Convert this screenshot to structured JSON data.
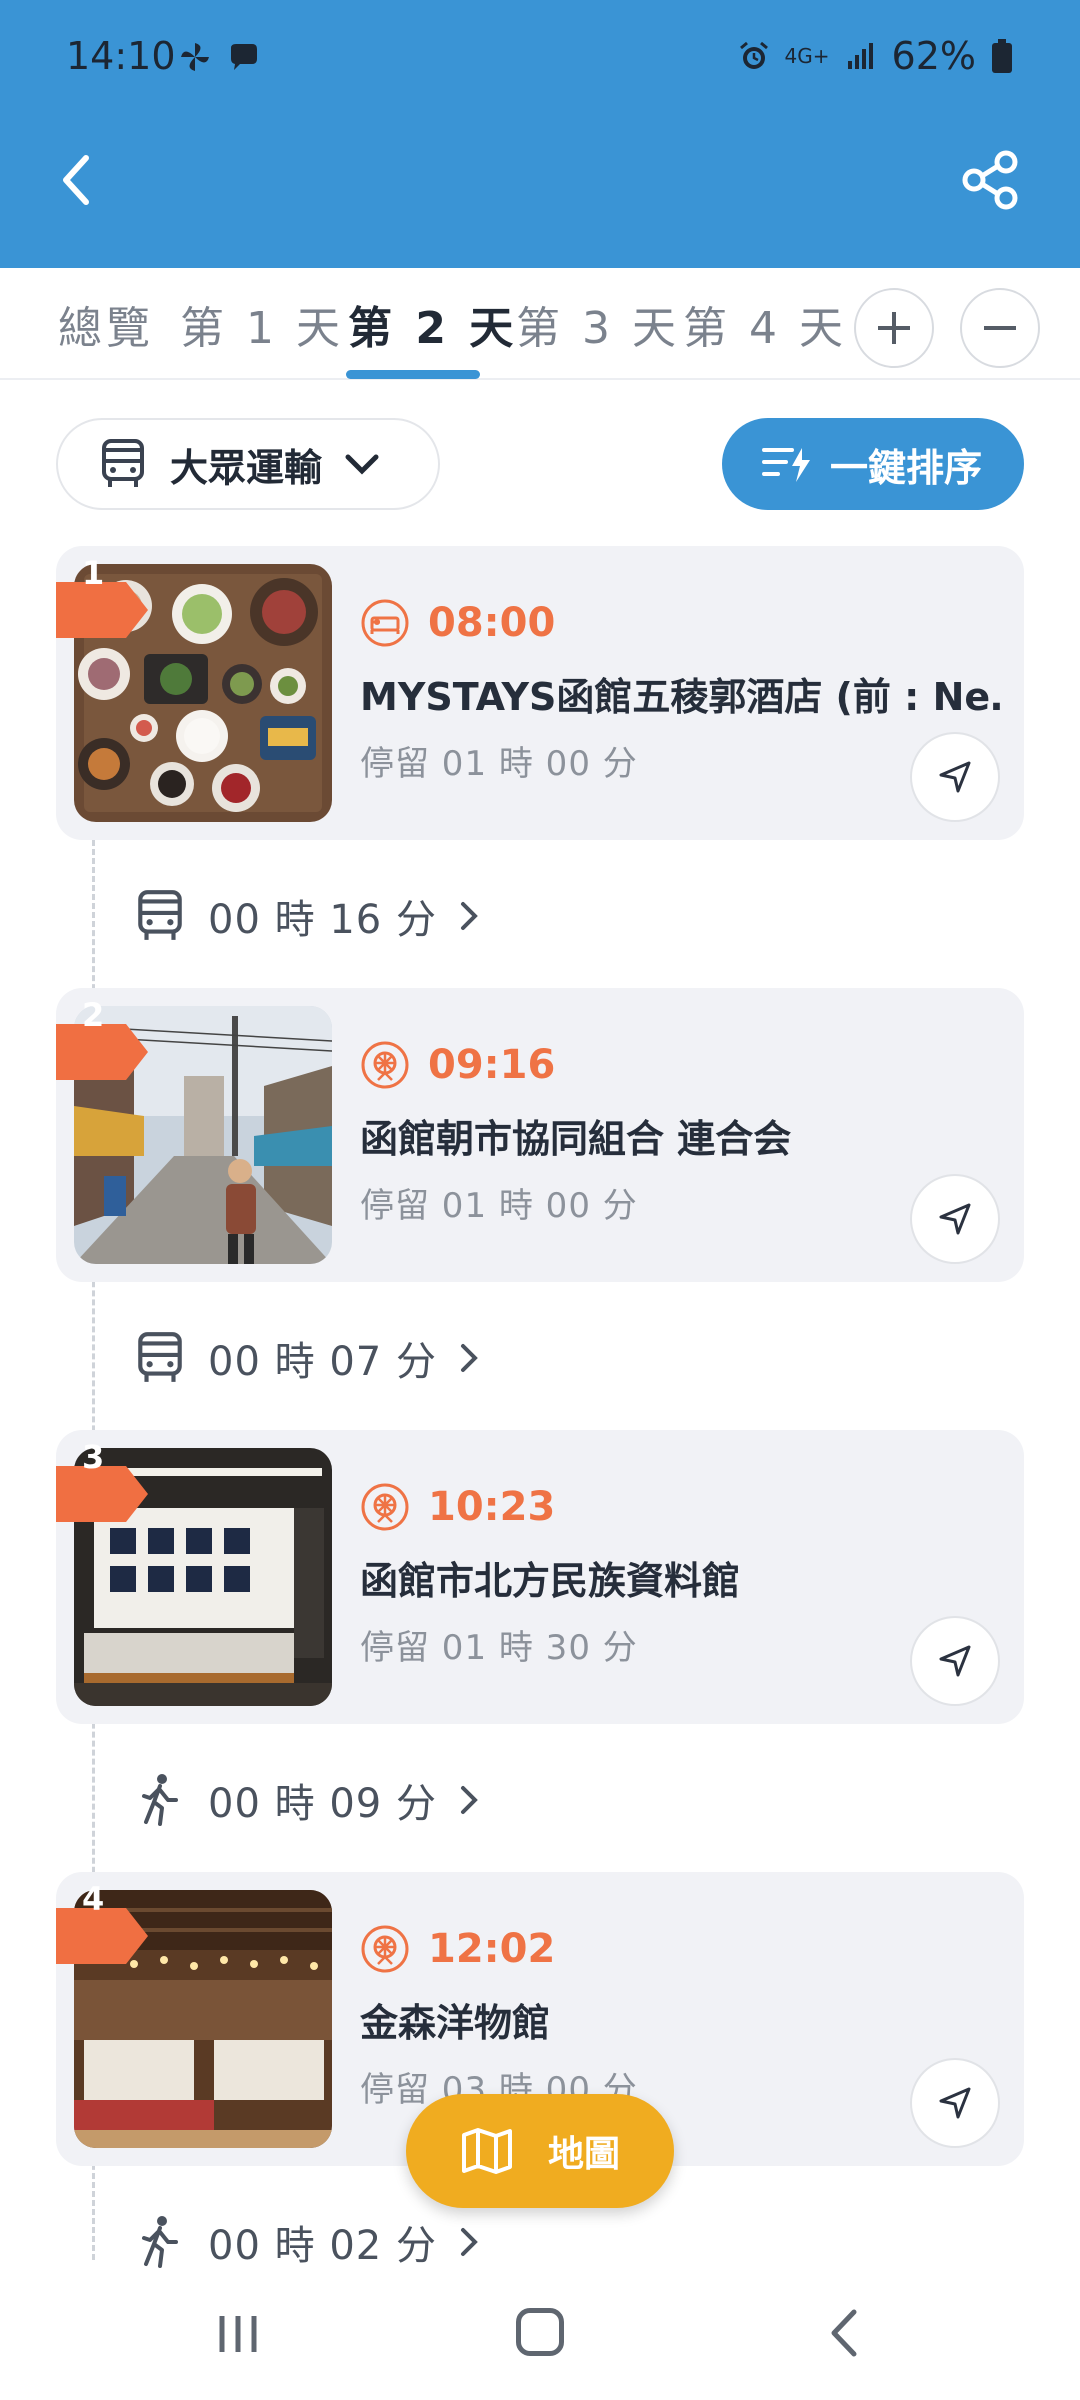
{
  "status": {
    "time": "14:10",
    "battery": "62%",
    "network": "4G+"
  },
  "tabs": [
    {
      "label": "總覽"
    },
    {
      "label": "第 1 天"
    },
    {
      "label": "第 2 天"
    },
    {
      "label": "第 3 天"
    },
    {
      "label": "第 4 天"
    }
  ],
  "active_tab": "第 2 天",
  "controls": {
    "transport_label": "大眾運輸",
    "sort_label": "一鍵排序"
  },
  "stops": [
    {
      "num": "1",
      "time": "08:00",
      "title": "MYSTAYS函館五稜郭酒店 (前 : Ne…",
      "stay": "停留 01 時 00 分",
      "icon": "hotel-icon"
    },
    {
      "num": "2",
      "time": "09:16",
      "title": "函館朝市協同組合 連合会",
      "stay": "停留 01 時 00 分",
      "icon": "attraction-icon"
    },
    {
      "num": "3",
      "time": "10:23",
      "title": "函館市北方民族資料館",
      "stay": "停留 01 時 30 分",
      "icon": "attraction-icon"
    },
    {
      "num": "4",
      "time": "12:02",
      "title": "金森洋物館",
      "stay": "停留 03 時 00 分",
      "icon": "attraction-icon"
    }
  ],
  "segments": [
    {
      "mode": "bus-icon",
      "duration": "00 時 16 分"
    },
    {
      "mode": "bus-icon",
      "duration": "00 時 07 分"
    },
    {
      "mode": "walk-icon",
      "duration": "00 時 09 分"
    },
    {
      "mode": "walk-icon",
      "duration": "00 時 02 分"
    }
  ],
  "map_button": {
    "label": "地圖"
  },
  "colors": {
    "header_blue": "#3a94d5",
    "accent_orange": "#ef7345",
    "map_yellow": "#f0ac20",
    "card_bg": "#f1f2f6"
  }
}
